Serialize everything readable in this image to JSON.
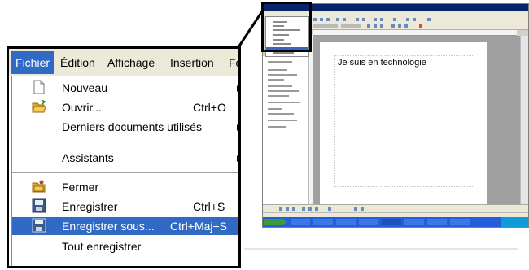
{
  "document": {
    "text": "Je suis en technologie"
  },
  "menubar": {
    "items": [
      {
        "label": "Fichier",
        "mnemonic": "F",
        "rest": "ichier"
      },
      {
        "label": "Édition",
        "mnemonic": "d",
        "pre": "É",
        "rest": "ition"
      },
      {
        "label": "Affichage",
        "mnemonic": "A",
        "rest": "ffichage"
      },
      {
        "label": "Insertion",
        "mnemonic": "I",
        "rest": "nsertion"
      },
      {
        "label": "Fo"
      }
    ]
  },
  "file_menu": {
    "items": [
      {
        "label": "Nouveau",
        "icon": "new-document-icon",
        "submenu": true
      },
      {
        "label": "Ouvrir...",
        "icon": "open-folder-icon",
        "shortcut": "Ctrl+O"
      },
      {
        "label": "Derniers documents utilisés",
        "submenu": true
      },
      {
        "label": "Assistants",
        "submenu": true
      },
      {
        "label": "Fermer",
        "icon": "close-folder-icon"
      },
      {
        "label": "Enregistrer",
        "icon": "save-floppy-icon",
        "shortcut": "Ctrl+S"
      },
      {
        "label": "Enregistrer sous...",
        "icon": "save-as-floppy-icon",
        "shortcut": "Ctrl+Maj+S",
        "highlighted": true
      },
      {
        "label": "Tout enregistrer"
      }
    ]
  },
  "colors": {
    "highlight": "#316ac5",
    "menubar_bg": "#ece9d8",
    "title_bar": "#0a246a",
    "taskbar": "#245edb"
  }
}
